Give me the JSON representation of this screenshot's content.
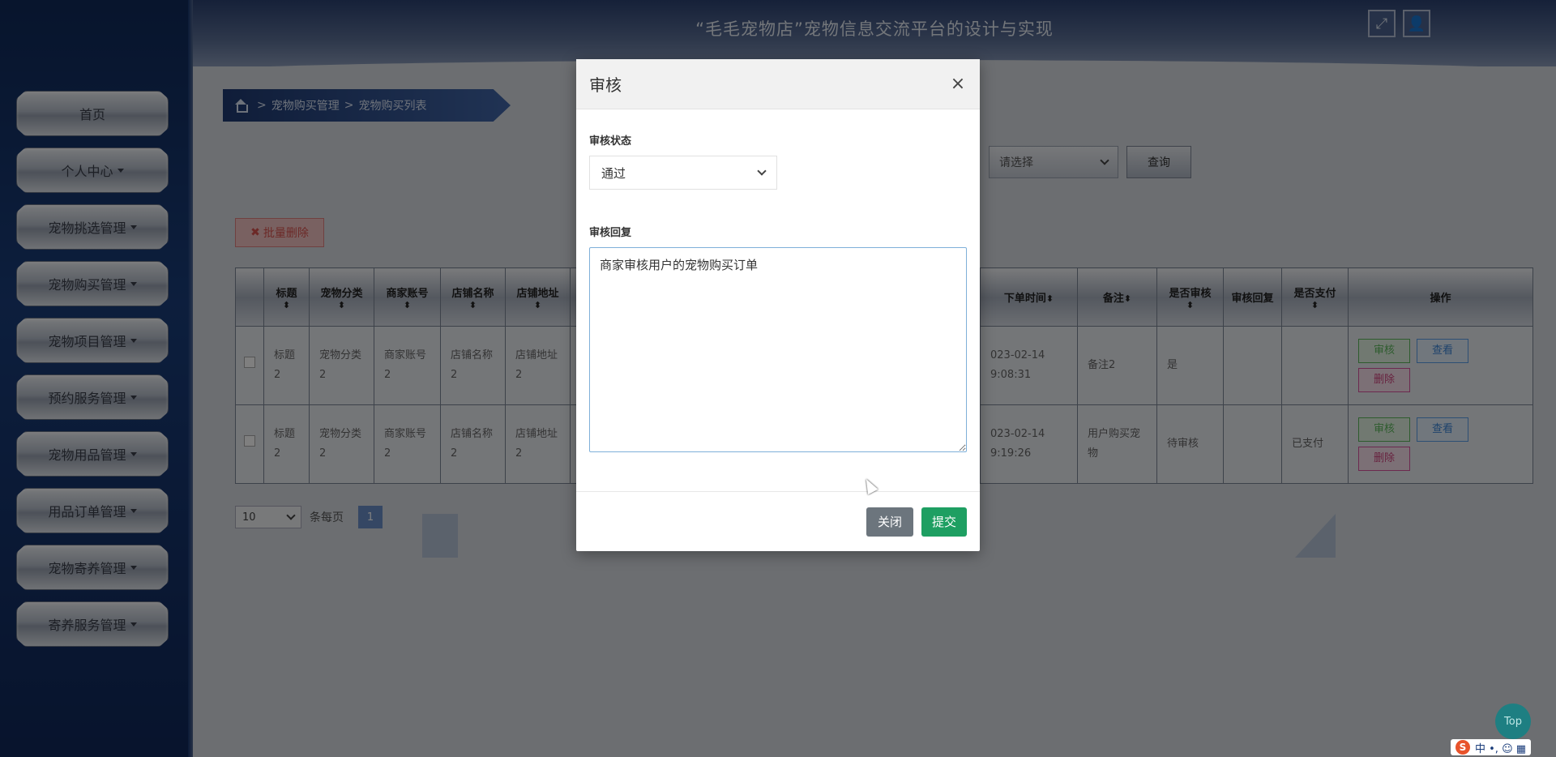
{
  "header": {
    "title": "“毛毛宠物店”宠物信息交流平台的设计与实现"
  },
  "sidebar": {
    "items": [
      {
        "label": "首页",
        "dropdown": false
      },
      {
        "label": "个人中心",
        "dropdown": true
      },
      {
        "label": "宠物挑选管理",
        "dropdown": true
      },
      {
        "label": "宠物购买管理",
        "dropdown": true
      },
      {
        "label": "宠物项目管理",
        "dropdown": true
      },
      {
        "label": "预约服务管理",
        "dropdown": true
      },
      {
        "label": "宠物用品管理",
        "dropdown": true
      },
      {
        "label": "用品订单管理",
        "dropdown": true
      },
      {
        "label": "宠物寄养管理",
        "dropdown": true
      },
      {
        "label": "寄养服务管理",
        "dropdown": true
      }
    ]
  },
  "breadcrumb": {
    "level1": "宠物购买管理",
    "level2": "宠物购买列表",
    "sep": ">"
  },
  "search": {
    "select_placeholder": "请选择",
    "button": "查询"
  },
  "toolbar": {
    "batch_delete": "批量删除"
  },
  "table": {
    "columns_left": [
      "标题",
      "宠物分类",
      "商家账号",
      "店铺名称",
      "店铺地址"
    ],
    "columns_right": [
      "下单时间",
      "备注",
      "是否审核",
      "审核回复",
      "是否支付",
      "操作"
    ],
    "rows": [
      {
        "title": "标题2",
        "category": "宠物分类2",
        "account": "商家账号2",
        "shop": "店铺名称2",
        "address": "店铺地址2",
        "time_a": "023-02-14",
        "time_b": "9:08:31",
        "remark": "备注2",
        "audited": "是",
        "reply": "",
        "paid": ""
      },
      {
        "title": "标题2",
        "category": "宠物分类2",
        "account": "商家账号2",
        "shop": "店铺名称2",
        "address": "店铺地址2",
        "time_a": "023-02-14",
        "time_b": "9:19:26",
        "remark": "用户购买宠物",
        "audited": "待审核",
        "reply": "",
        "paid": "已支付"
      }
    ],
    "ops": {
      "audit": "审核",
      "view": "查看",
      "delete": "删除"
    }
  },
  "pager": {
    "page_size": "10",
    "per_page_label": "条每页",
    "current_page": "1"
  },
  "modal": {
    "title": "审核",
    "close_symbol": "×",
    "status_label": "审核状态",
    "status_value": "通过",
    "reply_label": "审核回复",
    "reply_value": "商家审核用户的宠物购买订单",
    "close_button": "关闭",
    "submit_button": "提交"
  },
  "widgets": {
    "top_button": "Top",
    "ime_logo": "S",
    "ime_text": "中 •, ☺ ▦"
  }
}
